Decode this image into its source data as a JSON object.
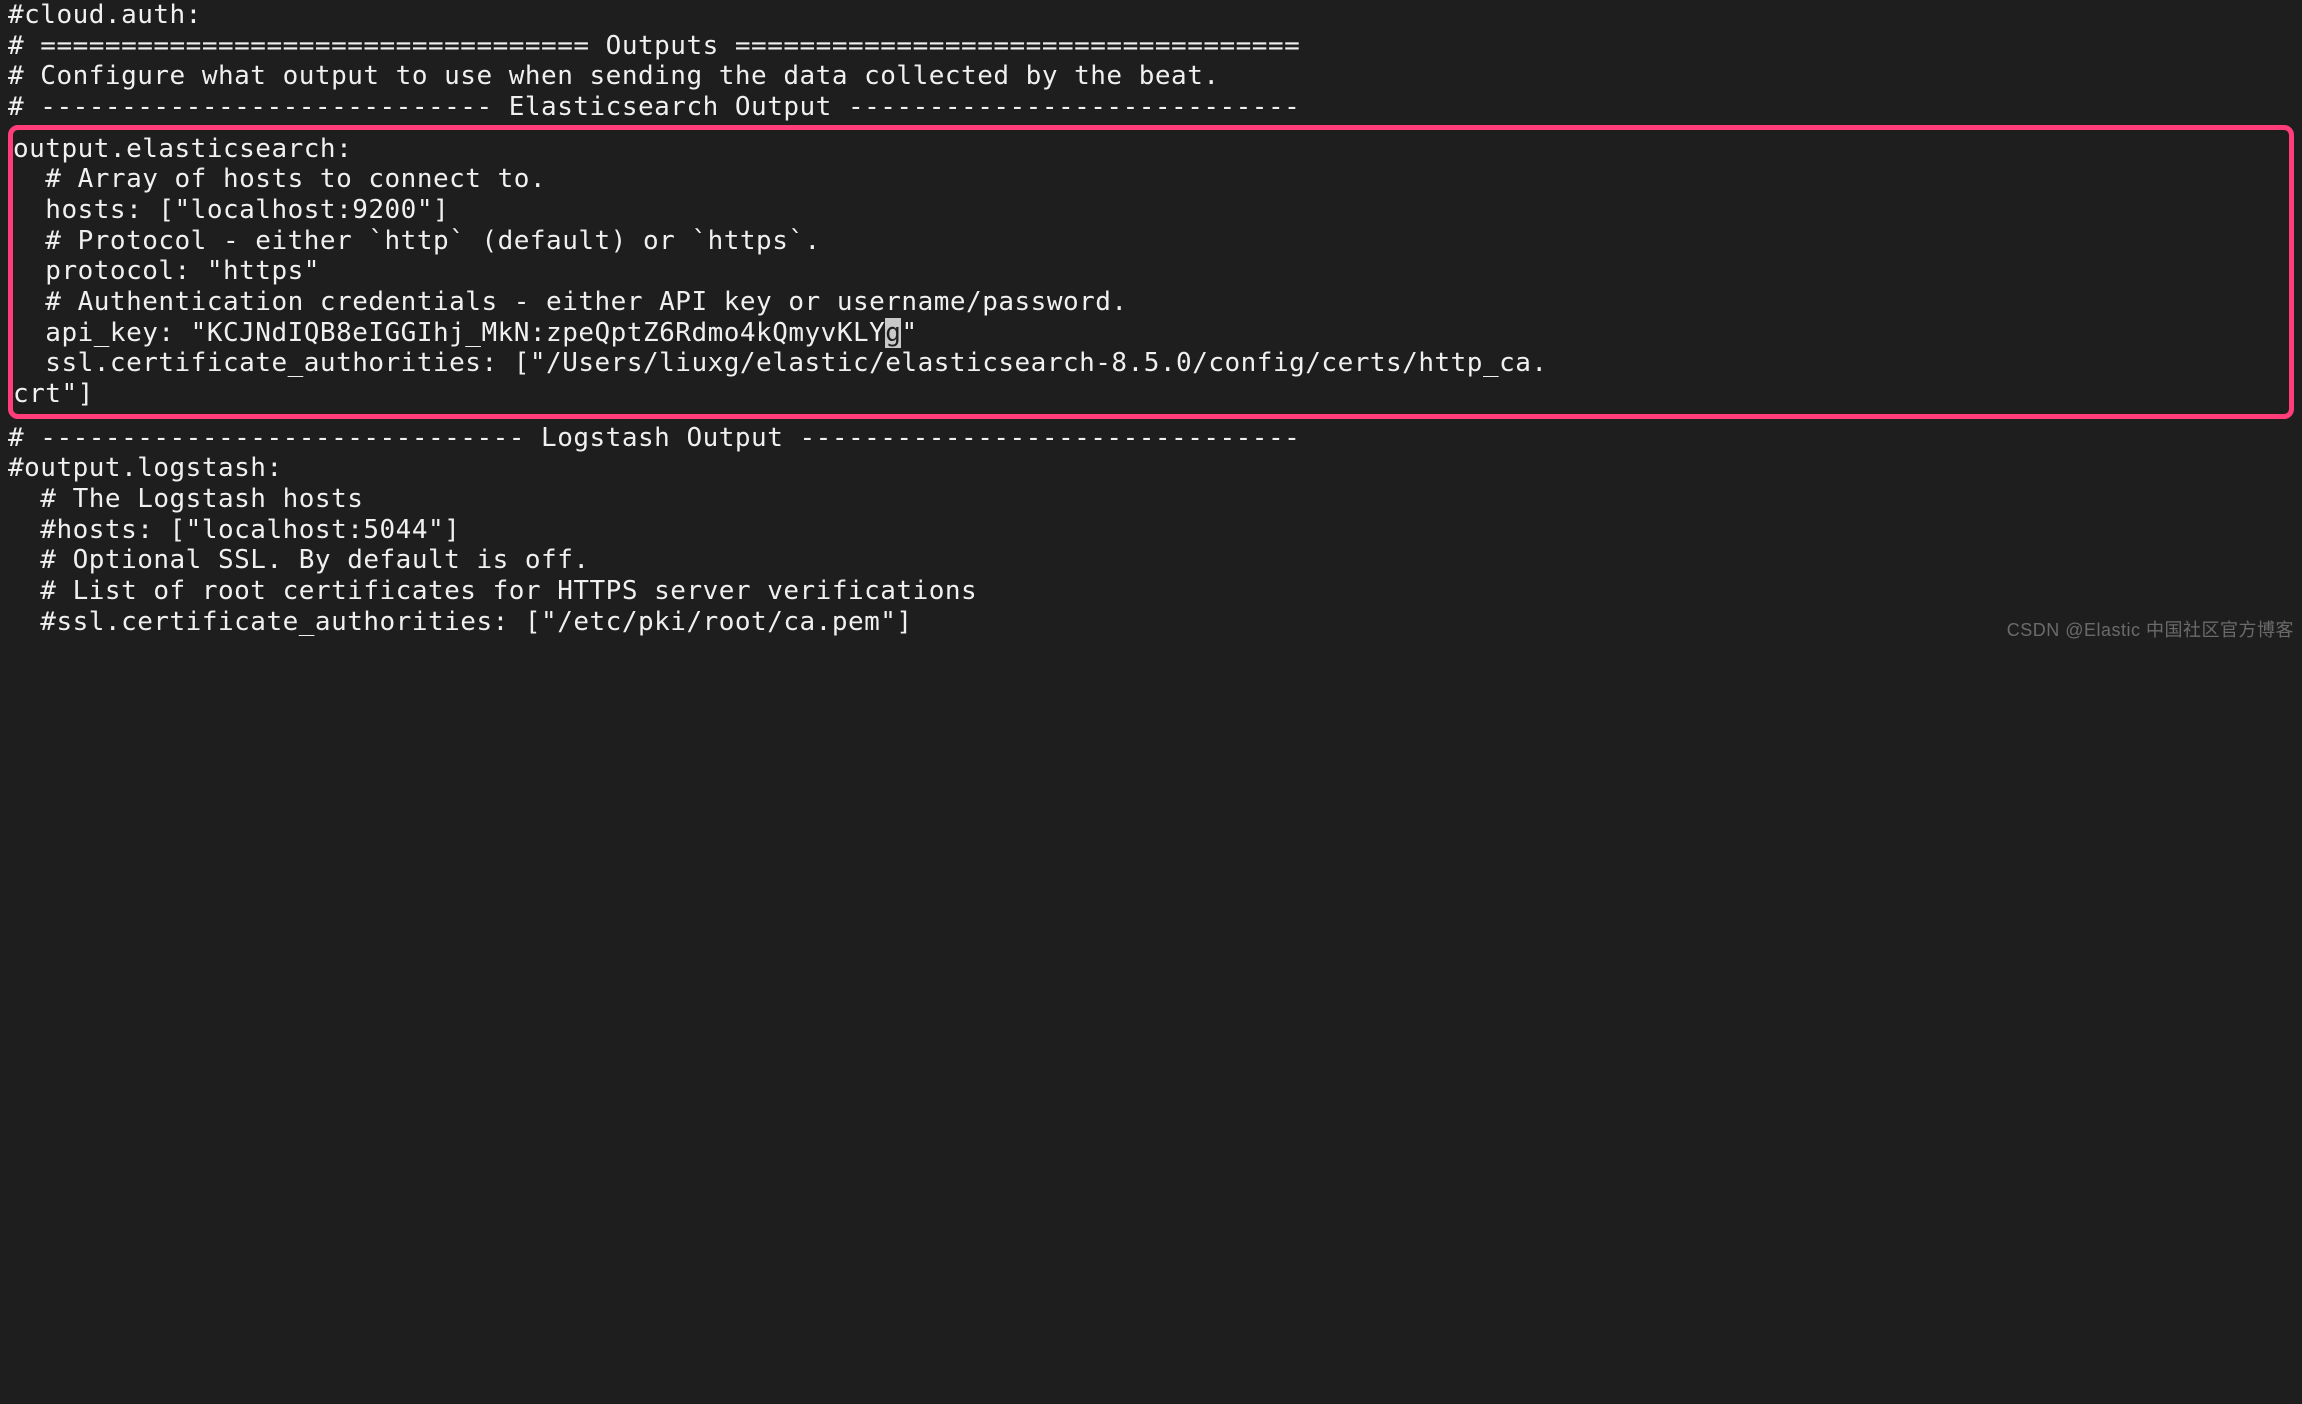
{
  "config": {
    "cloud_auth_line": "#cloud.auth:",
    "blank": "",
    "outputs_header": "# ================================== Outputs ===================================",
    "outputs_desc": "# Configure what output to use when sending the data collected by the beat.",
    "es_header": "# ---------------------------- Elasticsearch Output ----------------------------",
    "es": {
      "key": "output.elasticsearch:",
      "hosts_comment": "  # Array of hosts to connect to.",
      "hosts": "  hosts: [\"localhost:9200\"]",
      "protocol_comment": "  # Protocol - either `http` (default) or `https`.",
      "protocol": "  protocol: \"https\"",
      "auth_comment": "  # Authentication credentials - either API key or username/password.",
      "api_key_prefix": "  api_key: \"KCJNdIQB8eIGGIhj_MkN:zpeQptZ6Rdmo4kQmyvKLY",
      "api_key_cursor": "g",
      "api_key_suffix": "\"",
      "ssl_ca": "  ssl.certificate_authorities: [\"/Users/liuxg/elastic/elasticsearch-8.5.0/config/certs/http_ca.",
      "ssl_ca2": "crt\"]"
    },
    "logstash_header": "# ------------------------------ Logstash Output -------------------------------",
    "logstash": {
      "key": "#output.logstash:",
      "hosts_comment": "  # The Logstash hosts",
      "hosts": "  #hosts: [\"localhost:5044\"]",
      "ssl_comment1": "  # Optional SSL. By default is off.",
      "ssl_comment2": "  # List of root certificates for HTTPS server verifications",
      "ssl_ca": "  #ssl.certificate_authorities: [\"/etc/pki/root/ca.pem\"]"
    }
  },
  "watermark": "CSDN @Elastic 中国社区官方博客"
}
